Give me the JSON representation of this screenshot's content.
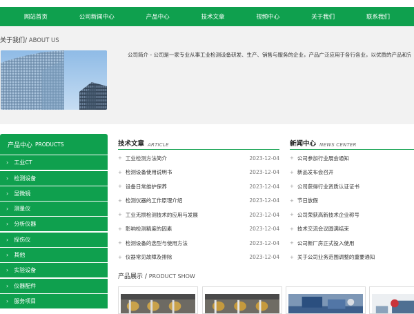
{
  "nav": [
    {
      "label": "网站首页"
    },
    {
      "label": "公司新闻中心"
    },
    {
      "label": "产品中心"
    },
    {
      "label": "技术文章"
    },
    {
      "label": "视频中心"
    },
    {
      "label": "关于我们"
    },
    {
      "label": "联系我们"
    }
  ],
  "about": {
    "title_cn": "关于我们/",
    "title_en": " ABOUT US",
    "text": "公司简介 - 公司是一家专业从事工业检测设备研发、生产、销售与服务的企业，产品广泛应用于各行各业，以优质的产品和完善的服务赢得客户信赖"
  },
  "sidebar": {
    "title_cn": "产品中心",
    "title_en": "PRODUCTS",
    "items": [
      {
        "label": "工业CT"
      },
      {
        "label": "检测设备"
      },
      {
        "label": "显微镜"
      },
      {
        "label": "测量仪"
      },
      {
        "label": "分析仪器"
      },
      {
        "label": "探伤仪"
      },
      {
        "label": "其他"
      },
      {
        "label": "实验设备"
      },
      {
        "label": "仪器配件"
      },
      {
        "label": "服务项目"
      }
    ]
  },
  "article": {
    "title_cn": "技术文章",
    "title_en": "ARTICLE",
    "rows": [
      {
        "text": "工业检测方法简介",
        "date": "2023-12-04"
      },
      {
        "text": "检测设备使用说明书",
        "date": "2023-12-04"
      },
      {
        "text": "设备日常维护保养",
        "date": "2023-12-04"
      },
      {
        "text": "检测仪器的工作原理介绍",
        "date": "2023-12-04"
      },
      {
        "text": "工业无损检测技术的应用与发展",
        "date": "2023-12-04"
      },
      {
        "text": "影响检测精度的因素",
        "date": "2023-12-04"
      },
      {
        "text": "检测设备的选型与使用方法",
        "date": "2023-12-04"
      },
      {
        "text": "仪器常见故障及排除",
        "date": "2023-12-04"
      }
    ]
  },
  "news": {
    "title_cn": "新闻中心",
    "title_en": "NEWS CENTER",
    "rows": [
      {
        "text": "公司参加行业展会通知"
      },
      {
        "text": "新品发布会召开"
      },
      {
        "text": "公司获得行业资质认证证书"
      },
      {
        "text": "节日放假"
      },
      {
        "text": "公司荣获高新技术企业称号"
      },
      {
        "text": "技术交流会议圆满结束"
      },
      {
        "text": "公司新厂房正式投入使用"
      },
      {
        "text": "关于公司业务范围调整的重要通知"
      }
    ]
  },
  "products": {
    "title_cn": "产品展示",
    "title_sep": " / ",
    "title_en": "PRODUCT SHOW"
  }
}
